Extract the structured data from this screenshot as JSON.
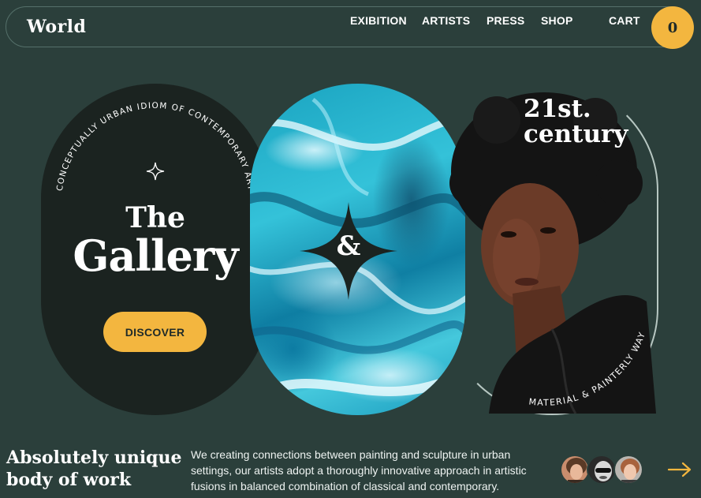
{
  "nav": {
    "logo": "World",
    "links": [
      "EXIBITION",
      "ARTISTS",
      "PRESS",
      "SHOP",
      "CART"
    ],
    "cart_count": "0"
  },
  "hero": {
    "curved_text_left": "CONCEPTUALLY URBAN IDIOM OF CONTEMPORARY ART",
    "title_small": "The",
    "title_large": "Gallery",
    "discover_label": "DISCOVER",
    "ampersand": "&",
    "century": [
      "21st.",
      "century"
    ],
    "curved_text_right": "MATERIAL & PAINTERLY WAY"
  },
  "bottom": {
    "headline": [
      "Absolutely unique",
      "body of work"
    ],
    "description": "We creating connections between painting and sculpture in urban settings, our artists adopt a thoroughly innovative approach in artistic fusions in balanced combination of classical and contemporary.",
    "avatars": [
      "avatar-1",
      "avatar-2",
      "avatar-3"
    ]
  },
  "colors": {
    "background": "#2b3f3b",
    "accent": "#f3b63f",
    "dark_panel": "#1b2320",
    "marble": "#1aa3c0"
  }
}
